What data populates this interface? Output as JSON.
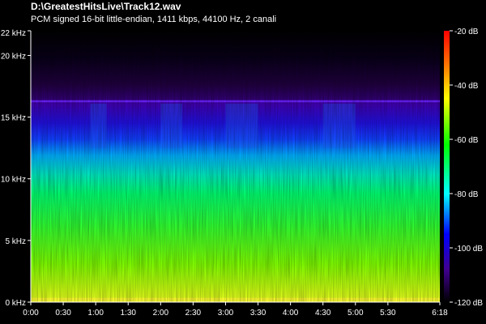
{
  "header": {
    "title": "D:\\GreatestHitsLive\\Track12.wav",
    "subtitle": "PCM signed 16-bit little-endian, 1411 kbps, 44100 Hz, 2 canali"
  },
  "chart_data": {
    "type": "heatmap",
    "title": "D:\\GreatestHitsLive\\Track12.wav",
    "subtitle": "PCM signed 16-bit little-endian, 1411 kbps, 44100 Hz, 2 canali",
    "x_axis": {
      "unit": "time (m:ss)",
      "range": [
        "0:00",
        "6:18"
      ],
      "range_seconds": [
        0,
        378
      ],
      "ticks": [
        "0:00",
        "0:30",
        "1:00",
        "1:30",
        "2:00",
        "2:30",
        "3:00",
        "3:30",
        "4:00",
        "4:30",
        "5:00",
        "5:30",
        "6:18"
      ],
      "tick_seconds": [
        0,
        30,
        60,
        90,
        120,
        150,
        180,
        210,
        240,
        270,
        300,
        330,
        378
      ]
    },
    "y_axis": {
      "unit": "kHz",
      "range": [
        0,
        22
      ],
      "ticks": [
        "0 kHz",
        "5 kHz",
        "10 kHz",
        "15 kHz",
        "20 kHz",
        "22 kHz"
      ],
      "tick_values": [
        0,
        5,
        10,
        15,
        20,
        22
      ]
    },
    "color_scale": {
      "unit": "dB",
      "range": [
        -120,
        -20
      ],
      "ticks": [
        "-20 dB",
        "-40 dB",
        "-60 dB",
        "-80 dB",
        "-100 dB",
        "-120 dB"
      ],
      "tick_values": [
        -20,
        -40,
        -60,
        -80,
        -100,
        -120
      ],
      "colors": [
        "#ff0000",
        "#ff8000",
        "#ffff00",
        "#00ff00",
        "#00ffff",
        "#0000ff",
        "#4000a0",
        "#000000"
      ]
    },
    "spectral_profile": [
      {
        "khz": 0.3,
        "db": -35
      },
      {
        "khz": 2,
        "db": -50
      },
      {
        "khz": 5,
        "db": -58
      },
      {
        "khz": 8,
        "db": -64
      },
      {
        "khz": 10.5,
        "db": -72
      },
      {
        "khz": 12.5,
        "db": -85
      },
      {
        "khz": 15,
        "db": -98
      },
      {
        "khz": 16.3,
        "db": -105
      },
      {
        "khz": 17,
        "db": -110
      },
      {
        "khz": 19,
        "db": -115
      },
      {
        "khz": 22,
        "db": -120
      }
    ],
    "lowpass_cutoff_khz": 16.3
  }
}
